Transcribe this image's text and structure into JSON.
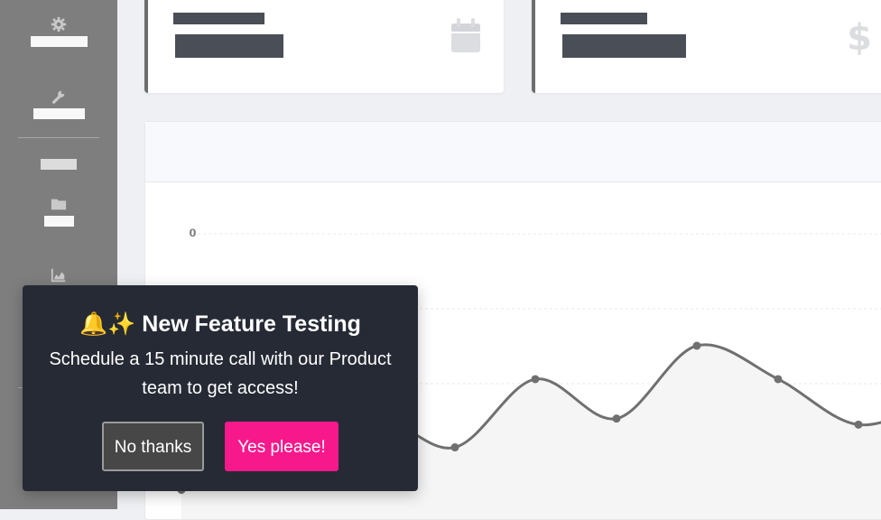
{
  "colors": {
    "sidebar_bg": "#7e7e7e",
    "modal_bg": "#262a35",
    "accent_pink": "#f7198c",
    "chart_line": "#707070"
  },
  "sidebar": {
    "items": [
      {
        "icon": "gear-icon"
      },
      {
        "icon": "wrench-icon"
      },
      {
        "icon": "none"
      },
      {
        "icon": "folder-icon"
      },
      {
        "icon": "chart-area-icon"
      }
    ]
  },
  "cards": [
    {
      "icon": "calendar-icon"
    },
    {
      "icon": "dollar-icon"
    }
  ],
  "chart_data": {
    "type": "area",
    "y_tick_labels": [
      "0",
      "0"
    ],
    "series": [
      {
        "values": [
          0.05,
          0.18,
          0.52,
          0.33,
          0.78,
          0.52,
          1.0,
          0.78,
          0.48,
          0.65
        ]
      }
    ],
    "grid": true,
    "legend": "none"
  },
  "modal": {
    "emoji": "🔔✨",
    "title": "New Feature Testing",
    "body": "Schedule a 15 minute call with our Product team to get access!",
    "no_label": "No thanks",
    "yes_label": "Yes please!"
  }
}
